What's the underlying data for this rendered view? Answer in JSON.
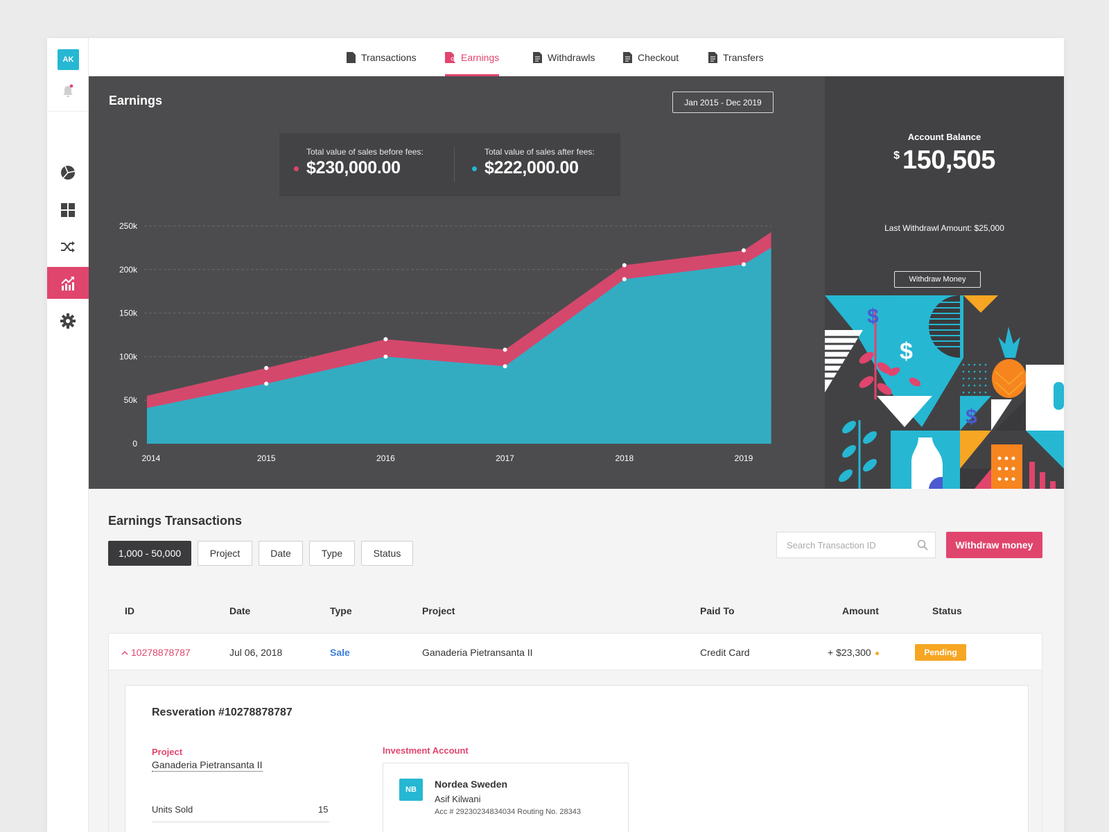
{
  "user": {
    "initials": "AK"
  },
  "sidebar": {
    "items": [
      {
        "icon": "pie-chart-icon"
      },
      {
        "icon": "grid-icon"
      },
      {
        "icon": "shuffle-icon"
      },
      {
        "icon": "chart-icon",
        "active": true
      },
      {
        "icon": "gear-icon"
      }
    ]
  },
  "tabs": [
    {
      "label": "Transactions",
      "icon": "document-icon"
    },
    {
      "label": "Earnings",
      "icon": "document-person-icon",
      "active": true
    },
    {
      "label": "Withdrawls",
      "icon": "document-icon"
    },
    {
      "label": "Checkout",
      "icon": "document-icon"
    },
    {
      "label": "Transfers",
      "icon": "document-icon"
    }
  ],
  "earnings": {
    "title": "Earnings",
    "date_range": "Jan 2015 - Dec 2019",
    "before_fees_label": "Total value of sales before fees:",
    "before_fees_value": "$230,000.00",
    "after_fees_label": "Total value of sales after fees:",
    "after_fees_value": "$222,000.00"
  },
  "chart_data": {
    "type": "area",
    "x": [
      "2014",
      "2015",
      "2016",
      "2017",
      "2018",
      "2019"
    ],
    "x_numeric": [
      2014,
      2015,
      2016,
      2017,
      2018,
      2019
    ],
    "x_end": 2019.23,
    "yticks": [
      0,
      50000,
      100000,
      150000,
      200000,
      250000
    ],
    "ytick_labels": [
      "0",
      "50k",
      "100k",
      "150k",
      "200k",
      "250k"
    ],
    "ylim": [
      0,
      250000
    ],
    "series": [
      {
        "color": "#d4486c",
        "values": [
          55000,
          87000,
          120000,
          108000,
          205000,
          222000
        ],
        "end_value": 243000
      },
      {
        "color": "#33acc2",
        "values": [
          41000,
          69000,
          100000,
          89000,
          189000,
          206000
        ],
        "end_value": 225000
      }
    ],
    "grid": true
  },
  "balance": {
    "title": "Account Balance",
    "currency": "$",
    "amount": "150,505",
    "last_withdrawal": "Last Withdrawl Amount: $25,000",
    "withdraw_label": "Withdraw Money"
  },
  "transactions": {
    "title": "Earnings Transactions",
    "filters": [
      "1,000 - 50,000",
      "Project",
      "Date",
      "Type",
      "Status"
    ],
    "search_placeholder": "Search Transaction ID",
    "withdraw_button": "Withdraw money",
    "columns": [
      "ID",
      "Date",
      "Type",
      "Project",
      "Paid To",
      "Amount",
      "Status"
    ],
    "rows": [
      {
        "id": "10278878787",
        "date": "Jul 06, 2018",
        "type": "Sale",
        "project": "Ganaderia Pietransanta II",
        "paid_to": "Credit Card",
        "amount": "+ $23,300",
        "status": "Pending"
      }
    ]
  },
  "detail": {
    "title": "Resveration #10278878787",
    "project_label": "Project",
    "project_value": "Ganaderia Pietransanta II",
    "units_label": "Units Sold",
    "units_value": "15",
    "investment_label": "Investment Account",
    "bank_initials": "NB",
    "bank_name": "Nordea Sweden",
    "holder": "Asif Kilwani",
    "account": "Acc # 29230234834034    Routing No. 28343"
  },
  "colors": {
    "accent": "#e0456d",
    "teal": "#26b7d3",
    "pending": "#f6a623",
    "dark_bg": "#4c4c4e"
  }
}
